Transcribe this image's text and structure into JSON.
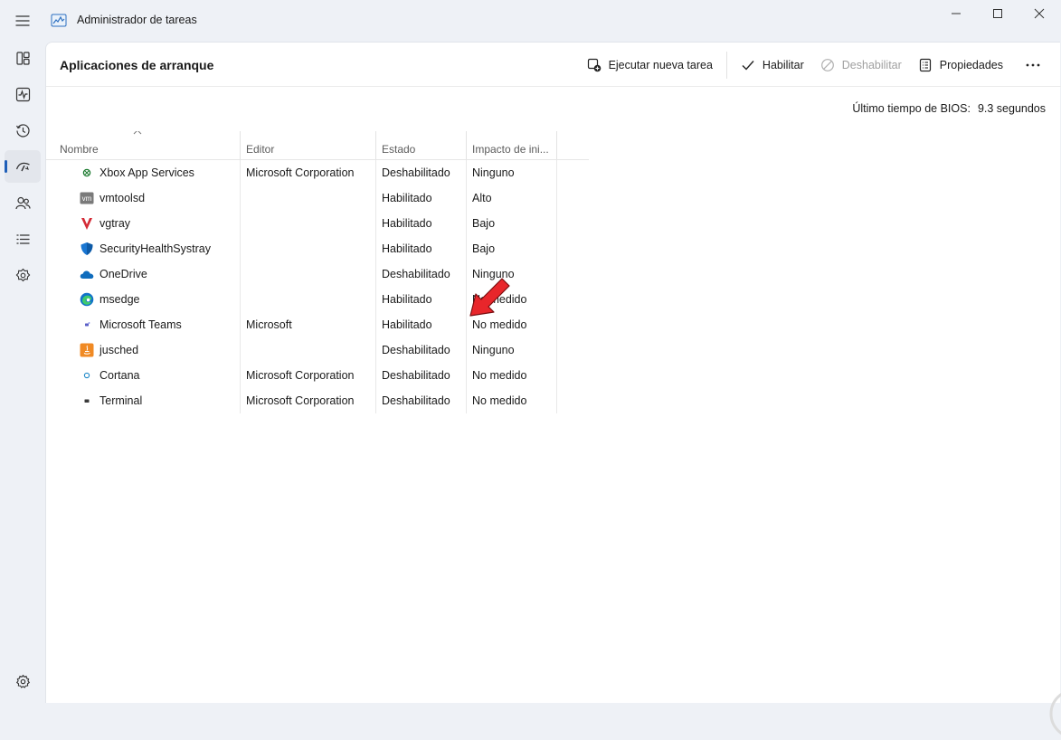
{
  "window": {
    "title": "Administrador de tareas",
    "controls": [
      "minimize-icon",
      "maximize-icon",
      "close-icon"
    ]
  },
  "nav": {
    "items": [
      {
        "name": "nav-processes",
        "icon": "processes-grid-icon"
      },
      {
        "name": "nav-performance",
        "icon": "performance-chart-icon"
      },
      {
        "name": "nav-app-history",
        "icon": "history-clock-icon"
      },
      {
        "name": "nav-startup-apps",
        "icon": "startup-gauge-icon",
        "active": true
      },
      {
        "name": "nav-users",
        "icon": "users-icon"
      },
      {
        "name": "nav-details",
        "icon": "details-list-icon"
      },
      {
        "name": "nav-services",
        "icon": "services-puzzle-icon"
      }
    ],
    "settings_icon": "gear-icon",
    "accent": "#1f5fb8"
  },
  "page": {
    "title": "Aplicaciones de arranque",
    "commands": {
      "run_new_task": "Ejecutar nueva tarea",
      "enable": "Habilitar",
      "disable": "Deshabilitar",
      "properties": "Propiedades"
    },
    "bios": {
      "label": "Último tiempo de BIOS:",
      "value": "9.3 segundos"
    }
  },
  "table": {
    "columns": [
      "Nombre",
      "Editor",
      "Estado",
      "Impacto de ini..."
    ],
    "rows": [
      {
        "name": "Xbox App Services",
        "publisher": "Microsoft Corporation",
        "status": "Deshabilitado",
        "impact": "Ninguno",
        "icon": "xbox-icon"
      },
      {
        "name": "vmtoolsd",
        "publisher": "",
        "status": "Habilitado",
        "impact": "Alto",
        "icon": "vmware-icon"
      },
      {
        "name": "vgtray",
        "publisher": "",
        "status": "Habilitado",
        "impact": "Bajo",
        "icon": "valorant-vanguard-icon"
      },
      {
        "name": "SecurityHealthSystray",
        "publisher": "",
        "status": "Habilitado",
        "impact": "Bajo",
        "icon": "windows-security-shield-icon"
      },
      {
        "name": "OneDrive",
        "publisher": "",
        "status": "Deshabilitado",
        "impact": "Ninguno",
        "icon": "onedrive-cloud-icon"
      },
      {
        "name": "msedge",
        "publisher": "",
        "status": "Habilitado",
        "impact": "No medido",
        "icon": "edge-icon"
      },
      {
        "name": "Microsoft Teams",
        "publisher": "Microsoft",
        "status": "Habilitado",
        "impact": "No medido",
        "icon": "teams-icon"
      },
      {
        "name": "jusched",
        "publisher": "",
        "status": "Deshabilitado",
        "impact": "Ninguno",
        "icon": "java-icon"
      },
      {
        "name": "Cortana",
        "publisher": "Microsoft Corporation",
        "status": "Deshabilitado",
        "impact": "No medido",
        "icon": "cortana-icon"
      },
      {
        "name": "Terminal",
        "publisher": "Microsoft Corporation",
        "status": "Deshabilitado",
        "impact": "No medido",
        "icon": "terminal-icon"
      }
    ]
  },
  "annotation": {
    "arrow_color": "#e8262b"
  }
}
